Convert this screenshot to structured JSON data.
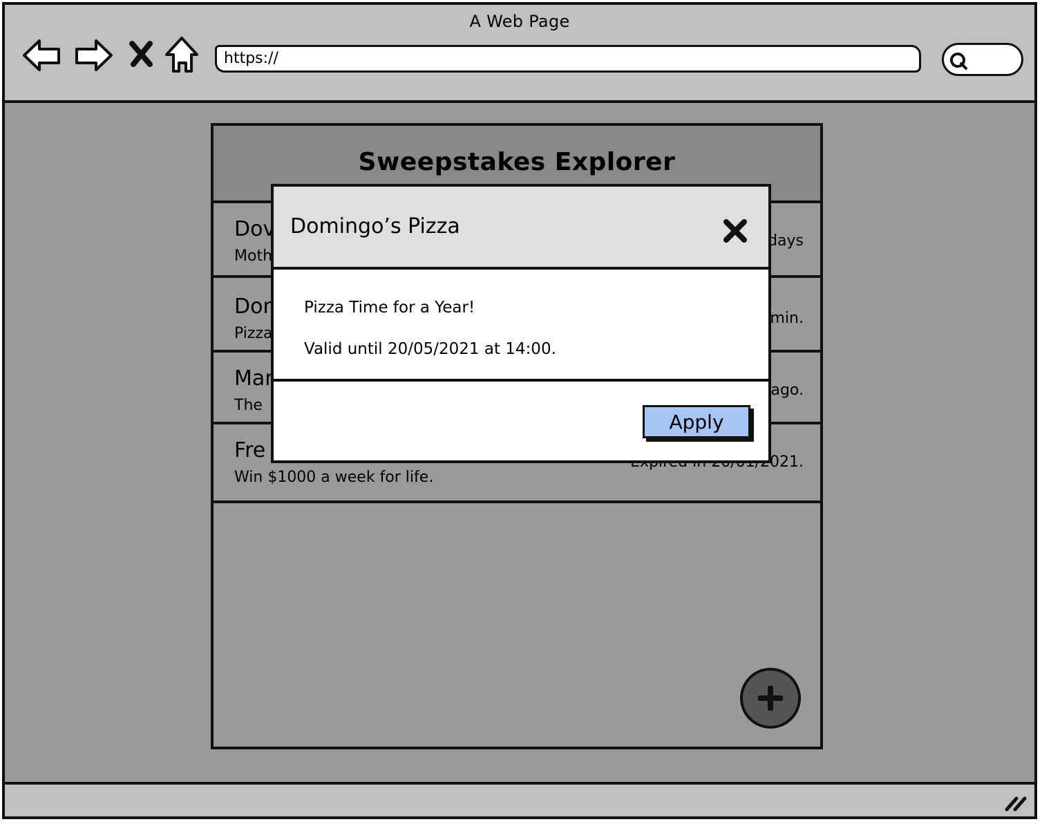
{
  "window": {
    "title": "A Web Page"
  },
  "toolbar": {
    "url": "https://",
    "back_icon": "back-arrow-icon",
    "forward_icon": "forward-arrow-icon",
    "stop_icon": "close-icon",
    "home_icon": "home-icon",
    "search_icon": "search-icon"
  },
  "app": {
    "title": "Sweepstakes Explorer",
    "rows": [
      {
        "title": "Dov",
        "subtitle": "Moth",
        "meta": "days"
      },
      {
        "title": "Don",
        "subtitle": "Pizza",
        "meta": "min."
      },
      {
        "title": "Mar",
        "subtitle": "The",
        "meta": "ago."
      },
      {
        "title": "Fre",
        "subtitle": "Win $1000 a week for life.",
        "meta": "Expired in 20/01/2021."
      }
    ],
    "add_icon": "plus-icon"
  },
  "modal": {
    "title": "Domingo’s Pizza",
    "close_icon": "close-icon",
    "description": "Pizza Time for a Year!",
    "validity": "Valid until 20/05/2021 at 14:00.",
    "apply_label": "Apply"
  },
  "colors": {
    "chrome": "#c0c0c0",
    "page_bg": "#9a9a9a",
    "app_header": "#888888",
    "modal_header": "#dedede",
    "apply_button": "#a8c4f4",
    "fab": "#555555"
  }
}
